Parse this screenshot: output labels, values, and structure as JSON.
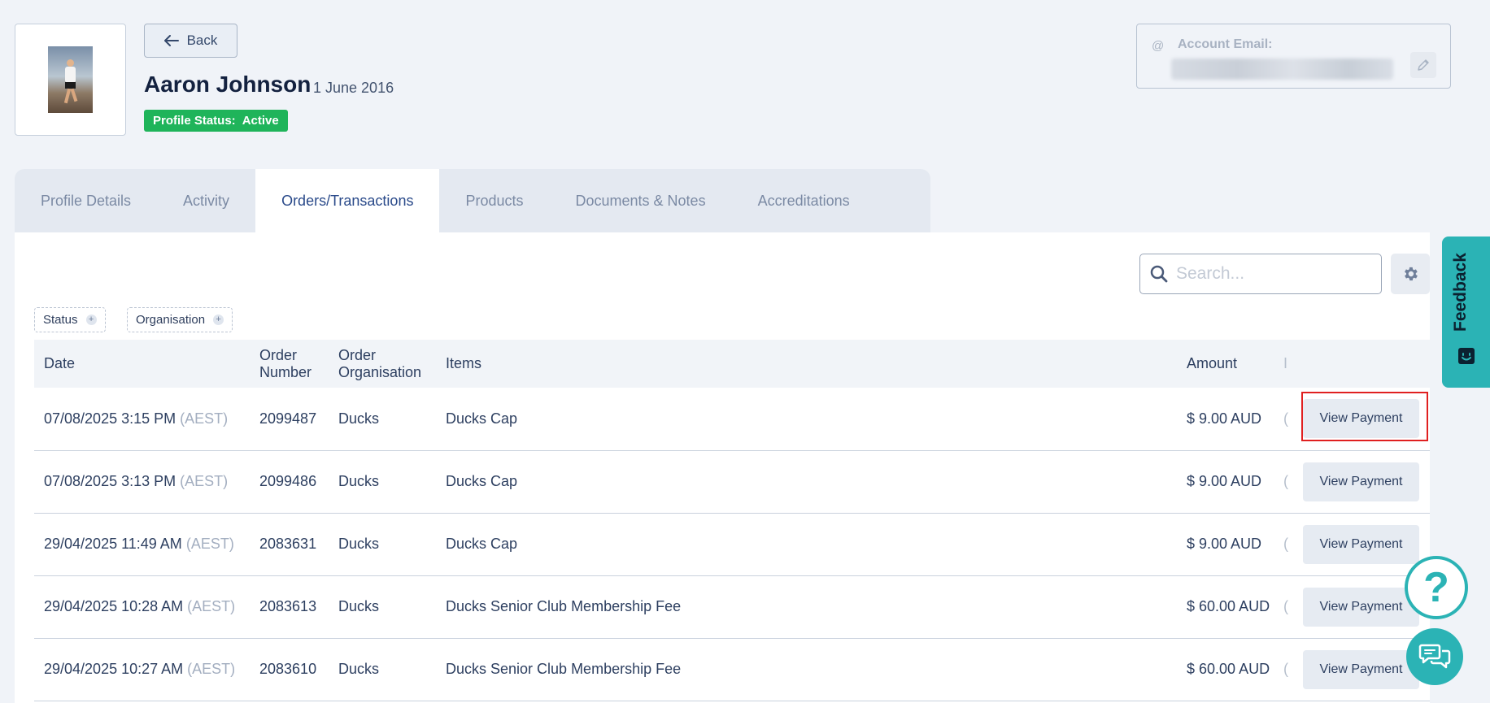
{
  "header": {
    "back_label": "Back",
    "name": "Aaron Johnson",
    "date": "1 June 2016",
    "status_label": "Profile Status:",
    "status_value": "Active",
    "account_email_label": "Account Email:"
  },
  "tabs": [
    {
      "label": "Profile Details",
      "active": false
    },
    {
      "label": "Activity",
      "active": false
    },
    {
      "label": "Orders/Transactions",
      "active": true
    },
    {
      "label": "Products",
      "active": false
    },
    {
      "label": "Documents & Notes",
      "active": false
    },
    {
      "label": "Accreditations",
      "active": false
    }
  ],
  "search": {
    "placeholder": "Search..."
  },
  "filters": {
    "status_label": "Status",
    "organisation_label": "Organisation"
  },
  "table": {
    "columns": {
      "date": "Date",
      "order_number_1": "Order",
      "order_number_2": "Number",
      "order_org_1": "Order",
      "order_org_2": "Organisation",
      "items": "Items",
      "amount": "Amount",
      "truncated": "I"
    },
    "rows": [
      {
        "date": "07/08/2025 3:15 PM",
        "tz": "(AEST)",
        "order": "2099487",
        "org": "Ducks",
        "item": "Ducks Cap",
        "amount": "$ 9.00 AUD",
        "trunc": "(",
        "action": "View Payment"
      },
      {
        "date": "07/08/2025 3:13 PM",
        "tz": "(AEST)",
        "order": "2099486",
        "org": "Ducks",
        "item": "Ducks Cap",
        "amount": "$ 9.00 AUD",
        "trunc": "(",
        "action": "View Payment"
      },
      {
        "date": "29/04/2025 11:49 AM",
        "tz": "(AEST)",
        "order": "2083631",
        "org": "Ducks",
        "item": "Ducks Cap",
        "amount": "$ 9.00 AUD",
        "trunc": "(",
        "action": "View Payment"
      },
      {
        "date": "29/04/2025 10:28 AM",
        "tz": "(AEST)",
        "order": "2083613",
        "org": "Ducks",
        "item": "Ducks Senior Club Membership Fee",
        "amount": "$ 60.00 AUD",
        "trunc": "(",
        "action": "View Payment"
      },
      {
        "date": "29/04/2025 10:27 AM",
        "tz": "(AEST)",
        "order": "2083610",
        "org": "Ducks",
        "item": "Ducks Senior Club Membership Fee",
        "amount": "$ 60.00 AUD",
        "trunc": "(",
        "action": "View Payment"
      }
    ]
  },
  "widgets": {
    "feedback_label": "Feedback",
    "help_glyph": "?"
  },
  "colors": {
    "accent_teal": "#2bb3b5",
    "status_green": "#1fb45a",
    "active_tab_text": "#2a4a8a",
    "highlight_red": "#e02020"
  },
  "icons": [
    "arrow-left-icon",
    "at-icon",
    "pencil-icon",
    "search-icon",
    "gear-icon",
    "plus-icon",
    "smile-icon",
    "help-icon",
    "chat-icon"
  ]
}
